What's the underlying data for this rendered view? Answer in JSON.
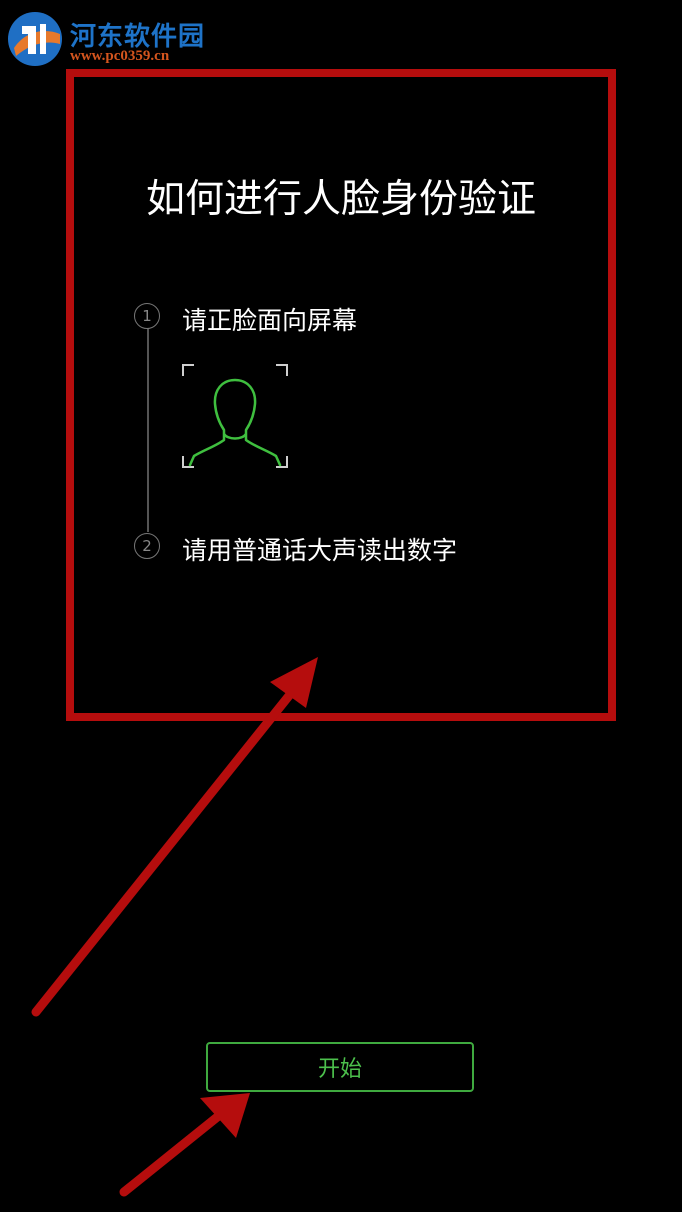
{
  "watermark": {
    "site_name": "河东软件园",
    "url": "www.pc0359.cn"
  },
  "guide": {
    "title": "如何进行人脸身份验证",
    "steps": [
      {
        "number": "1",
        "text": "请正脸面向屏幕"
      },
      {
        "number": "2",
        "text": "请用普通话大声读出数字"
      }
    ]
  },
  "action": {
    "start_label": "开始"
  },
  "colors": {
    "background": "#000000",
    "accent_green": "#3fa93f",
    "annotation_red": "#b50d0d"
  },
  "icons": {
    "face_scan": "face-scan-icon",
    "logo": "site-logo-icon"
  }
}
